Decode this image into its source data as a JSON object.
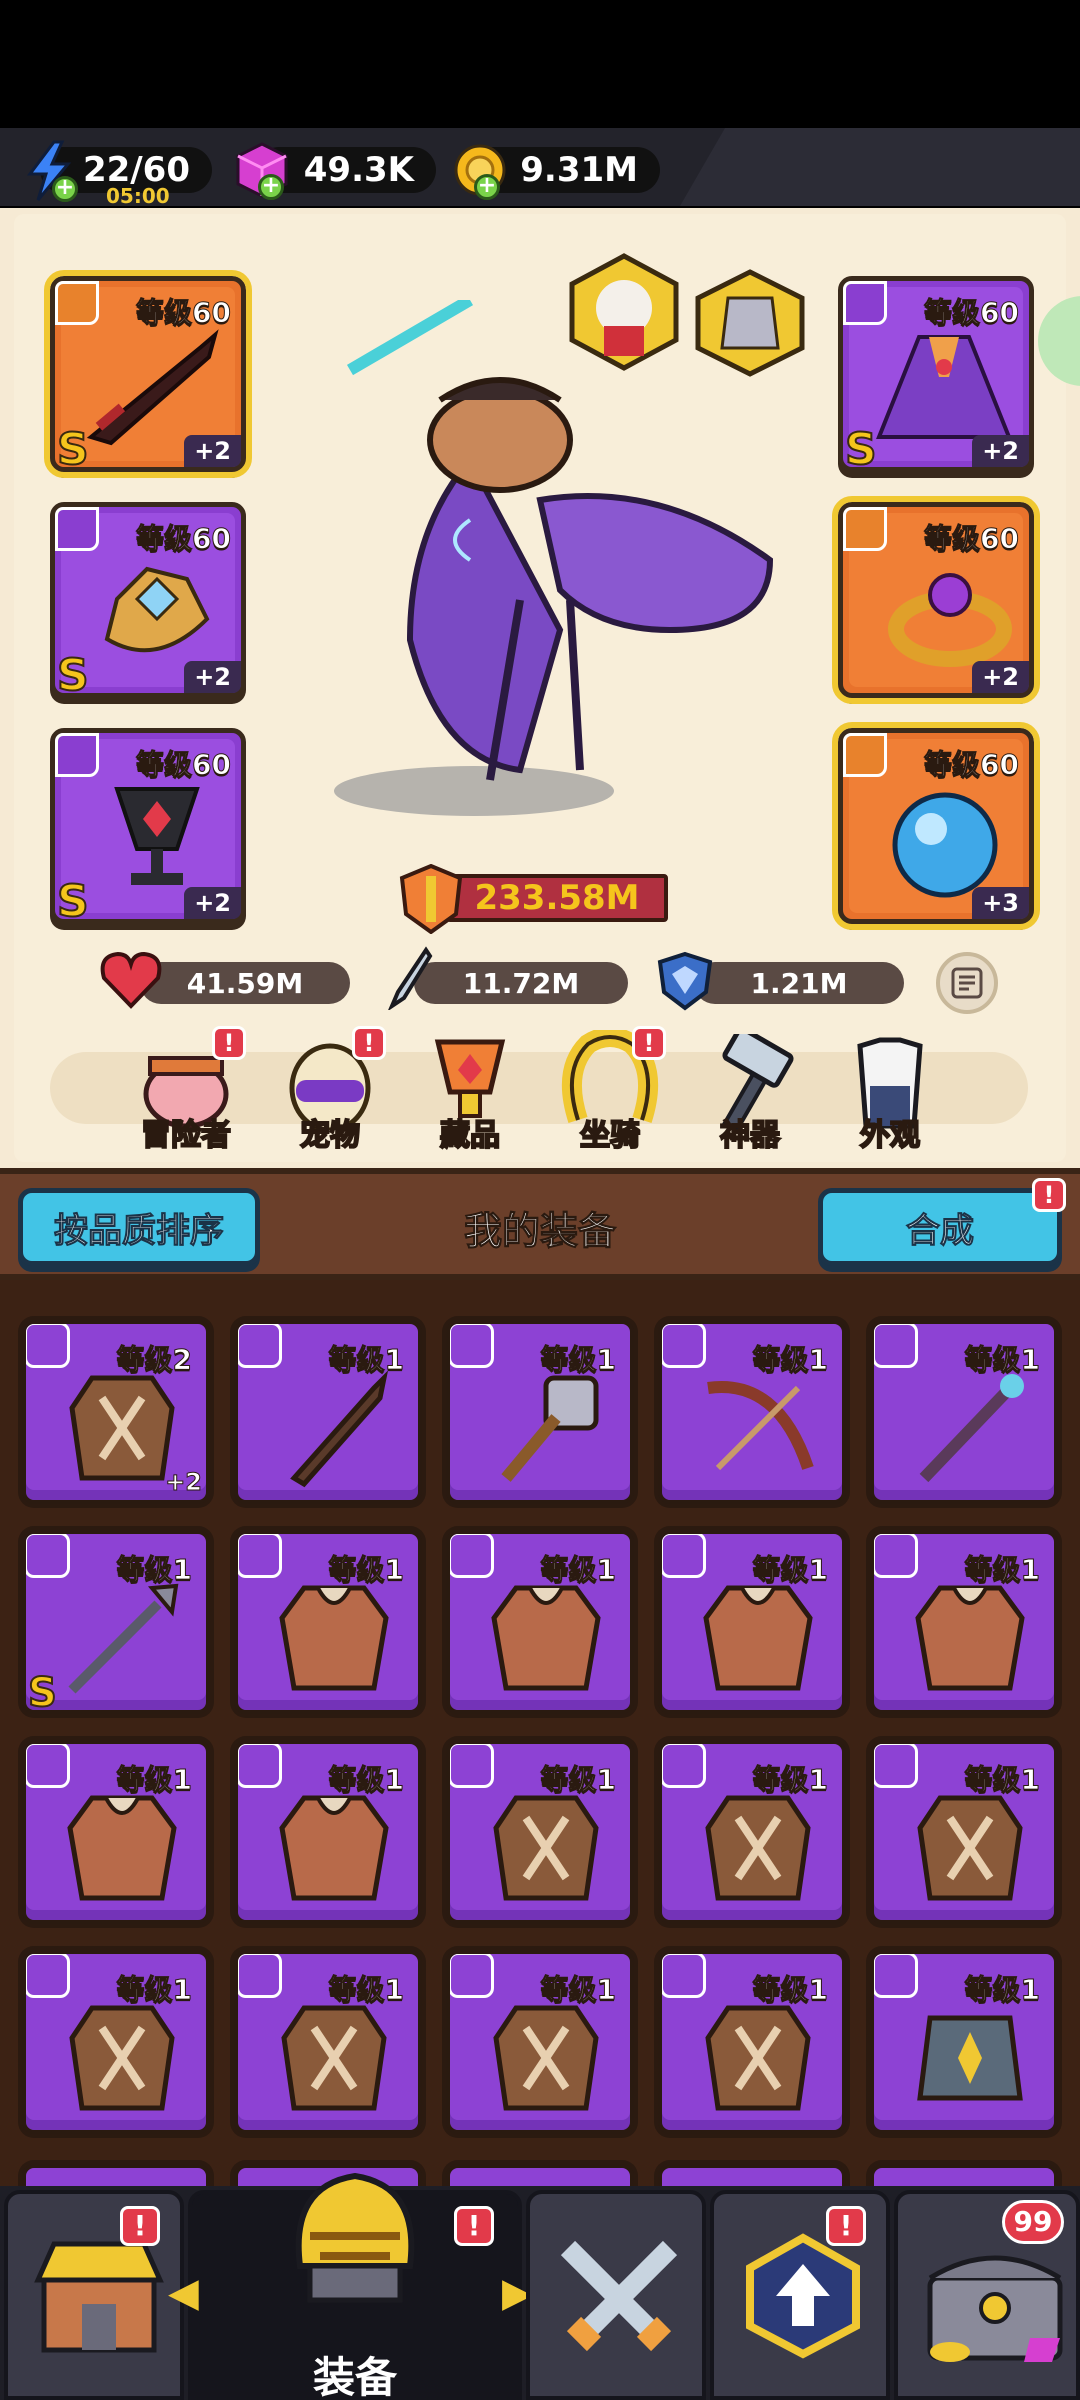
{
  "resources": {
    "energy": "22/60",
    "energy_timer": "05:00",
    "gems": "49.3K",
    "gold": "9.31M"
  },
  "hero": {
    "power": "233.58M",
    "stats": {
      "hp": "41.59M",
      "attack": "11.72M",
      "defense": "1.21M"
    }
  },
  "equipped": [
    {
      "level": "等级60",
      "rank": "S",
      "plus": "+2"
    },
    {
      "level": "等级60",
      "rank": "S",
      "plus": "+2"
    },
    {
      "level": "等级60",
      "rank": "S",
      "plus": "+2"
    },
    {
      "level": "等级60",
      "rank": "S",
      "plus": "+2"
    },
    {
      "level": "等级60",
      "rank": "",
      "plus": "+2"
    },
    {
      "level": "等级60",
      "rank": "",
      "plus": "+3"
    }
  ],
  "nav": {
    "items": [
      "冒险者",
      "宠物",
      "藏品",
      "坐骑",
      "神器",
      "外观"
    ],
    "badges": [
      "!",
      "!",
      "!"
    ]
  },
  "section": {
    "sort_button": "按品质排序",
    "title": "我的装备",
    "merge_button": "合成",
    "merge_badge": "!"
  },
  "inventory": [
    {
      "level": "等级2",
      "rank": "",
      "plus": "+2"
    },
    {
      "level": "等级1",
      "rank": "",
      "plus": ""
    },
    {
      "level": "等级1",
      "rank": "",
      "plus": ""
    },
    {
      "level": "等级1",
      "rank": "",
      "plus": ""
    },
    {
      "level": "等级1",
      "rank": "",
      "plus": ""
    },
    {
      "level": "等级1",
      "rank": "S",
      "plus": ""
    },
    {
      "level": "等级1",
      "rank": "",
      "plus": ""
    },
    {
      "level": "等级1",
      "rank": "",
      "plus": ""
    },
    {
      "level": "等级1",
      "rank": "",
      "plus": ""
    },
    {
      "level": "等级1",
      "rank": "",
      "plus": ""
    },
    {
      "level": "等级1",
      "rank": "",
      "plus": ""
    },
    {
      "level": "等级1",
      "rank": "",
      "plus": ""
    },
    {
      "level": "等级1",
      "rank": "",
      "plus": ""
    },
    {
      "level": "等级1",
      "rank": "",
      "plus": ""
    },
    {
      "level": "等级1",
      "rank": "",
      "plus": ""
    },
    {
      "level": "等级1",
      "rank": "",
      "plus": ""
    },
    {
      "level": "等级1",
      "rank": "",
      "plus": ""
    },
    {
      "level": "等级1",
      "rank": "",
      "plus": ""
    },
    {
      "level": "等级1",
      "rank": "",
      "plus": ""
    },
    {
      "level": "等级1",
      "rank": "",
      "plus": ""
    }
  ],
  "tabbar": {
    "active_label": "装备",
    "badges": [
      "!",
      "!",
      "!"
    ],
    "chest_count": "99"
  },
  "colors": {
    "purple": "#8d42d4",
    "orange": "#f07f36",
    "gold_border": "#f0c832",
    "cyan": "#42c4e6"
  }
}
